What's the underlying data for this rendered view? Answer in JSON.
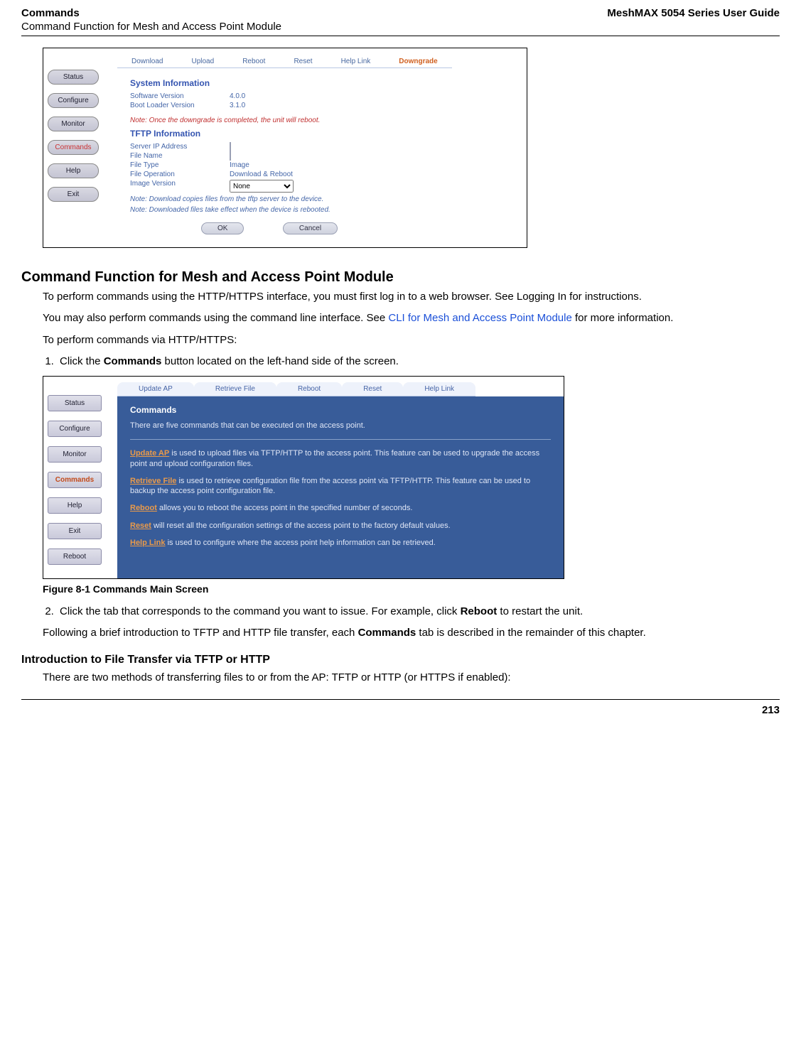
{
  "header": {
    "left_top": "Commands",
    "left_sub": "Command Function for Mesh and Access Point Module",
    "right": "MeshMAX 5054 Series User Guide"
  },
  "page_number": "213",
  "shot1": {
    "side": [
      "Status",
      "Configure",
      "Monitor",
      "Commands",
      "Help",
      "Exit"
    ],
    "side_active_index": 3,
    "tabs": [
      "Download",
      "Upload",
      "Reboot",
      "Reset",
      "Help Link",
      "Downgrade"
    ],
    "tab_active_index": 5,
    "sysinfo_title": "System Information",
    "sysinfo_rows": [
      {
        "k": "Software Version",
        "v": "4.0.0"
      },
      {
        "k": "Boot Loader Version",
        "v": "3.1.0"
      }
    ],
    "note_red": "Note: Once the downgrade is completed, the unit will reboot.",
    "tftp_title": "TFTP Information",
    "tftp_rows": [
      {
        "k": "Server IP Address",
        "type": "input"
      },
      {
        "k": "File Name",
        "type": "input"
      },
      {
        "k": "File Type",
        "v": "Image"
      },
      {
        "k": "File Operation",
        "v": "Download & Reboot"
      },
      {
        "k": "Image Version",
        "type": "select",
        "v": "None"
      }
    ],
    "notes_blue": [
      "Note: Download copies files from the tftp server to the device.",
      "Note: Downloaded files take effect when the device is rebooted."
    ],
    "buttons": [
      "OK",
      "Cancel"
    ]
  },
  "section1": {
    "heading": "Command Function for Mesh and Access Point Module",
    "p1_a": "To perform commands using the HTTP/HTTPS interface, you must first log in to a web browser. See Logging In  for instructions.",
    "p2_a": "You may also perform commands using the command line interface. See ",
    "p2_link": "CLI for Mesh and Access Point Module",
    "p2_b": " for more information.",
    "p3": "To perform commands via HTTP/HTTPS:",
    "step1_a": "Click the ",
    "step1_b": "Commands",
    "step1_c": " button located on the left-hand side of the screen."
  },
  "shot2": {
    "side": [
      "Status",
      "Configure",
      "Monitor",
      "Commands",
      "Help",
      "Exit",
      "Reboot"
    ],
    "side_active_index": 3,
    "tabs": [
      "Update AP",
      "Retrieve File",
      "Reboot",
      "Reset",
      "Help Link"
    ],
    "heading": "Commands",
    "intro": "There are five commands that can be executed on the access point.",
    "items": [
      {
        "link": "Update AP",
        "text": " is used to upload files via TFTP/HTTP to the access point. This feature can be used to upgrade the access point and upload configuration files."
      },
      {
        "link": "Retrieve File",
        "text": " is used to retrieve configuration file from the access point via TFTP/HTTP. This feature can be used to backup the access point configuration file."
      },
      {
        "link": "Reboot",
        "text": " allows you to reboot the access point in the specified number of seconds."
      },
      {
        "link": "Reset",
        "text": " will reset all the configuration settings of the access point to the factory default values."
      },
      {
        "link": "Help Link",
        "text": " is used to configure where the access point help information can be retrieved."
      }
    ]
  },
  "fig_caption": "Figure 8-1 Commands Main Screen",
  "section1b": {
    "step2_a": "Click the tab that corresponds to the command you want to issue. For example, click ",
    "step2_b": "Reboot",
    "step2_c": " to restart the unit.",
    "p4_a": "Following a brief introduction to TFTP and HTTP file transfer, each ",
    "p4_b": "Commands",
    "p4_c": " tab is described in the remainder of this chapter."
  },
  "section2": {
    "heading": "Introduction to File Transfer via TFTP or HTTP",
    "p1": "There are two methods of transferring files to or from the AP: TFTP or HTTP (or HTTPS if enabled):"
  }
}
